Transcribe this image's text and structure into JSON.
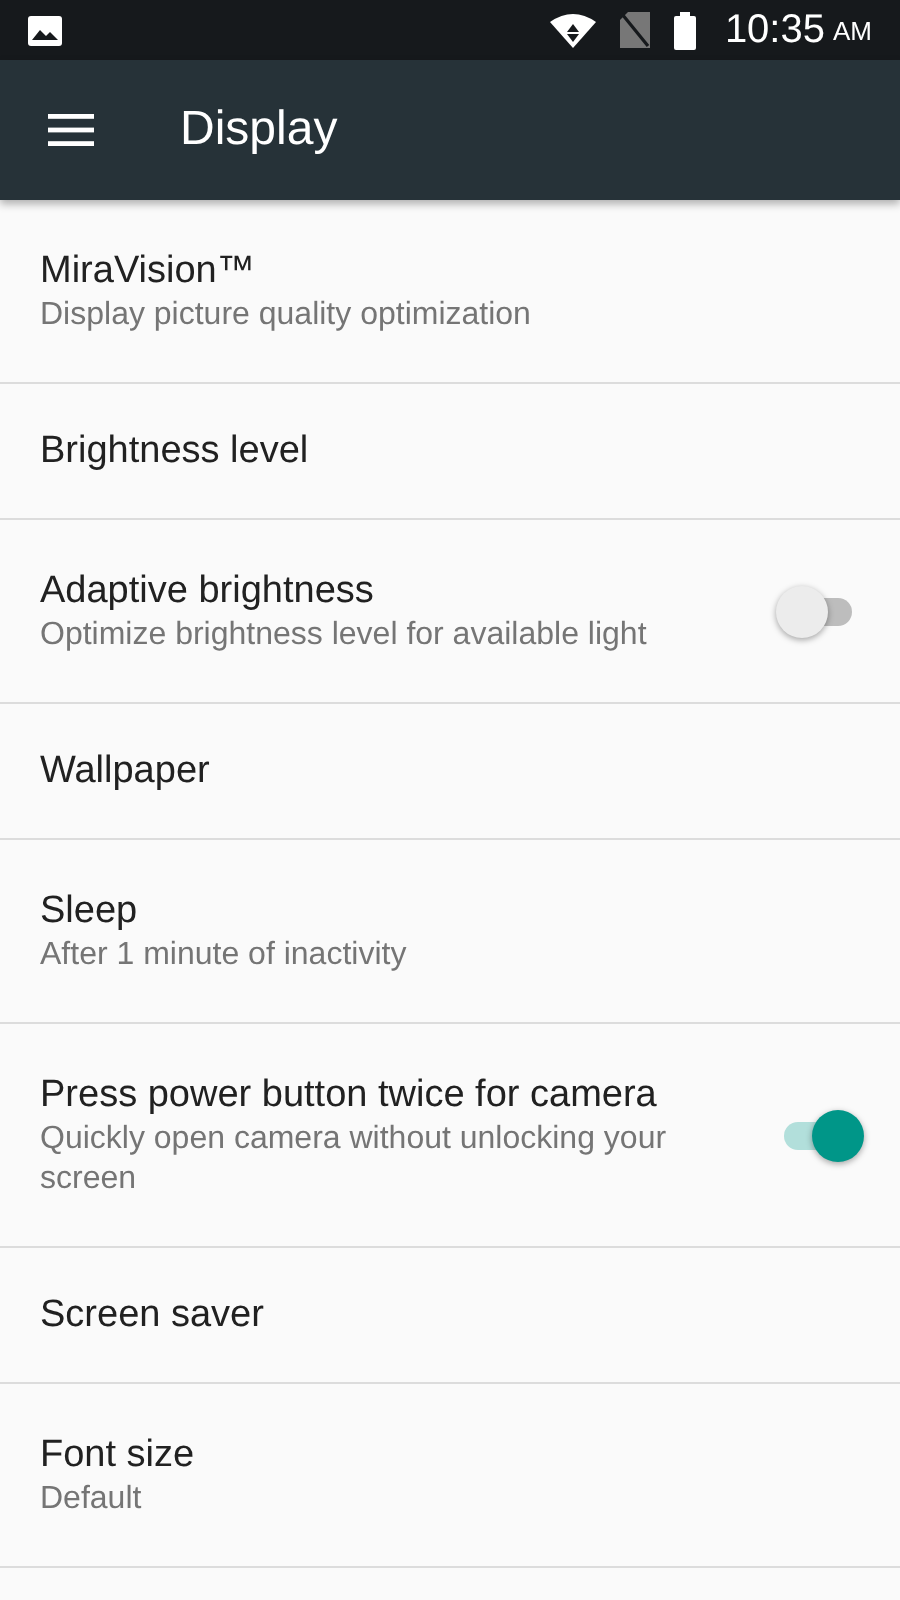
{
  "status_bar": {
    "time": "10:35",
    "period": "AM"
  },
  "app_bar": {
    "title": "Display"
  },
  "settings": [
    {
      "kind": "text",
      "title": "MiraVision™",
      "summary": "Display picture quality optimization"
    },
    {
      "kind": "text",
      "title": "Brightness level"
    },
    {
      "kind": "toggle",
      "title": "Adaptive brightness",
      "summary": "Optimize brightness level for available light",
      "on": false
    },
    {
      "kind": "text",
      "title": "Wallpaper"
    },
    {
      "kind": "text",
      "title": "Sleep",
      "summary": "After 1 minute of inactivity"
    },
    {
      "kind": "toggle",
      "title": "Press power button twice for camera",
      "summary": "Quickly open camera without unlocking your screen",
      "on": true
    },
    {
      "kind": "text",
      "title": "Screen saver"
    },
    {
      "kind": "text",
      "title": "Font size",
      "summary": "Default"
    }
  ]
}
